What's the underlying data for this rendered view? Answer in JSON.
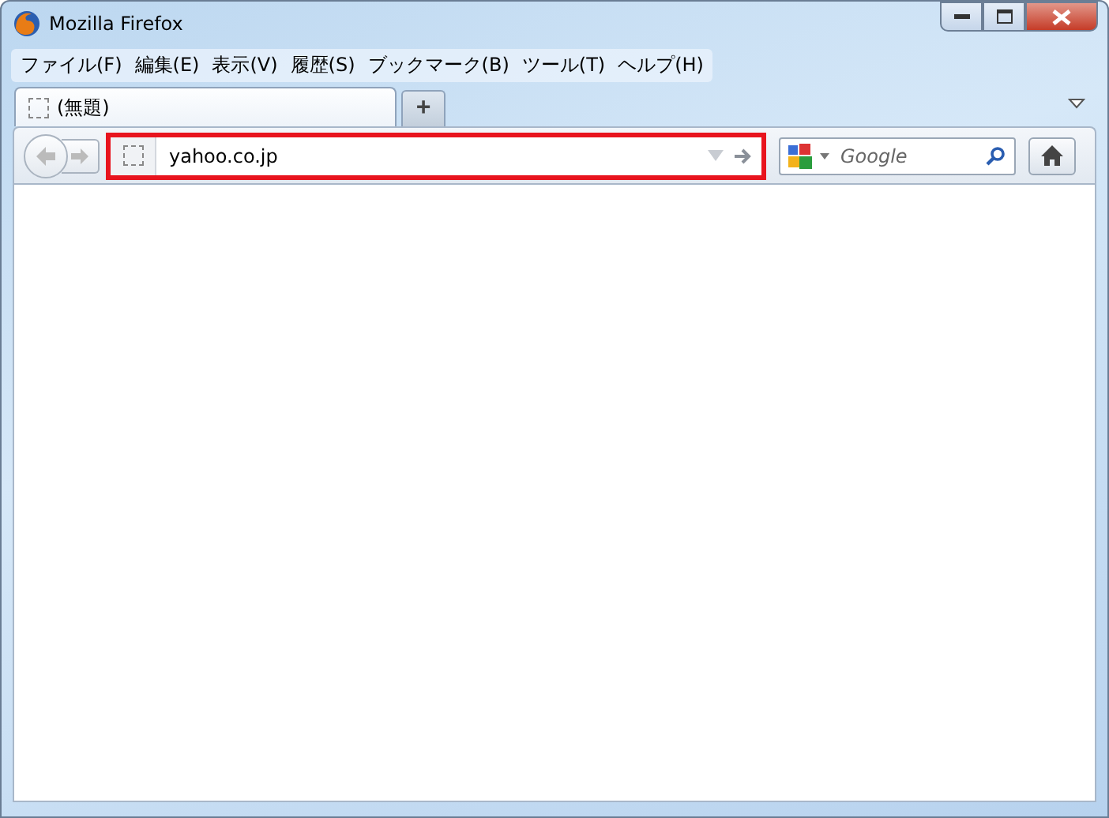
{
  "window": {
    "title": "Mozilla Firefox"
  },
  "menu": [
    "ファイル(F)",
    "編集(E)",
    "表示(V)",
    "履歴(S)",
    "ブックマーク(B)",
    "ツール(T)",
    "ヘルプ(H)"
  ],
  "tabs": [
    {
      "label": "(無題)",
      "selected": true
    }
  ],
  "new_tab": "+",
  "address_bar": {
    "value": "yahoo.co.jp",
    "highlighted": true
  },
  "search": {
    "placeholder": "Google"
  }
}
